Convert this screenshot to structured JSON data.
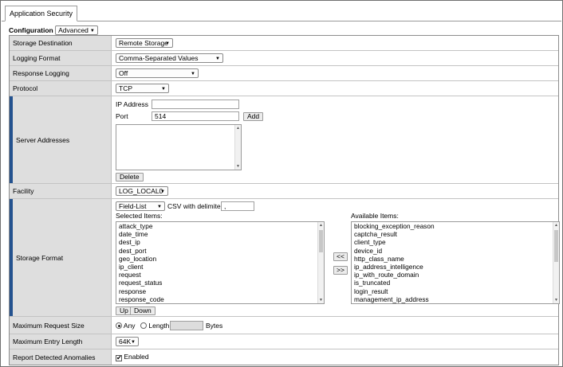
{
  "tab": {
    "label": "Application Security"
  },
  "configuration": {
    "label": "Configuration",
    "mode": "Advanced"
  },
  "rows": {
    "storage_destination": {
      "label": "Storage Destination",
      "value": "Remote Storage"
    },
    "logging_format": {
      "label": "Logging Format",
      "value": "Comma-Separated Values"
    },
    "response_logging": {
      "label": "Response Logging",
      "value": "Off"
    },
    "protocol": {
      "label": "Protocol",
      "value": "TCP"
    },
    "server_addresses": {
      "label": "Server Addresses",
      "ip_label": "IP Address",
      "ip_value": "",
      "port_label": "Port",
      "port_value": "514",
      "add_label": "Add",
      "delete_label": "Delete"
    },
    "facility": {
      "label": "Facility",
      "value": "LOG_LOCAL0"
    },
    "storage_format": {
      "label": "Storage Format",
      "format_type": "Field-List",
      "csv_label": "CSV with delimiter",
      "delimiter": ",",
      "selected_label": "Selected Items:",
      "available_label": "Available Items:",
      "move_left": "<<",
      "move_right": ">>",
      "up_label": "Up",
      "down_label": "Down",
      "selected_items": [
        "attack_type",
        "date_time",
        "dest_ip",
        "dest_port",
        "geo_location",
        "ip_client",
        "request",
        "request_status",
        "response",
        "response_code"
      ],
      "available_items": [
        "blocking_exception_reason",
        "captcha_result",
        "client_type",
        "device_id",
        "http_class_name",
        "ip_address_intelligence",
        "ip_with_route_domain",
        "is_truncated",
        "login_result",
        "management_ip_address"
      ]
    },
    "max_request_size": {
      "label": "Maximum Request Size",
      "any_label": "Any",
      "length_label": "Length",
      "length_value": "",
      "unit": "Bytes"
    },
    "max_entry_length": {
      "label": "Maximum Entry Length",
      "value": "64K"
    },
    "report_anomalies": {
      "label": "Report Detected Anomalies",
      "checkbox_label": "Enabled"
    }
  }
}
